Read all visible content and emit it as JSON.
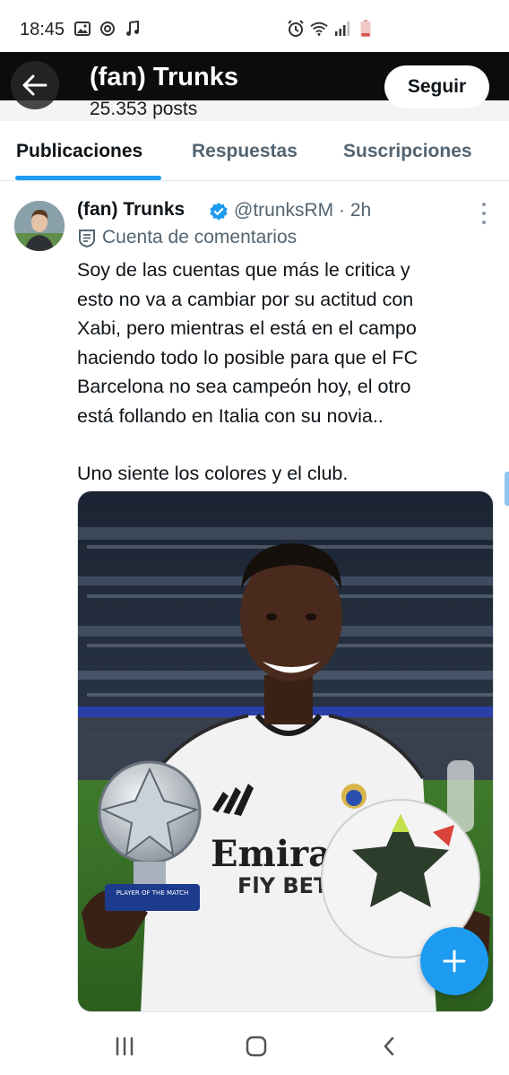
{
  "status_bar": {
    "time": "18:45",
    "left_icons": [
      "image-icon",
      "sync-icon",
      "music-note-icon"
    ],
    "right_icons": [
      "alarm-icon",
      "wifi-icon",
      "signal-icon",
      "battery-low-icon"
    ]
  },
  "header": {
    "name": "(fan) Trunks",
    "posts_count": "25.353 posts",
    "follow_label": "Seguir"
  },
  "tabs": [
    {
      "label": "Publicaciones",
      "active": true
    },
    {
      "label": "Respuestas",
      "active": false
    },
    {
      "label": "Suscripciones",
      "active": false
    }
  ],
  "post": {
    "author_name": "(fan) Trunks",
    "handle_time": "@trunksRM · 2h",
    "community_label": "Cuenta de comentarios",
    "text_lines": [
      "Soy de las cuentas que más le critica y",
      "esto no va a cambiar por su actitud con",
      "Xabi,  pero mientras el está en el campo",
      "haciendo todo lo posible para que el FC",
      "Barcelona no sea campeón hoy, el otro",
      "está follando en Italia con su novia.."
    ],
    "text_last_line": "Uno siente los colores y el club.",
    "media": {
      "shirt_sponsor_line1": "Emirat",
      "shirt_sponsor_line2": "FlY BETT",
      "trophy_label": "PLAYER OF THE MATCH"
    }
  },
  "colors": {
    "accent": "#1d9bf0",
    "header_bg": "#0c0c0c",
    "text_primary": "#0f1419",
    "text_secondary": "#536471"
  }
}
